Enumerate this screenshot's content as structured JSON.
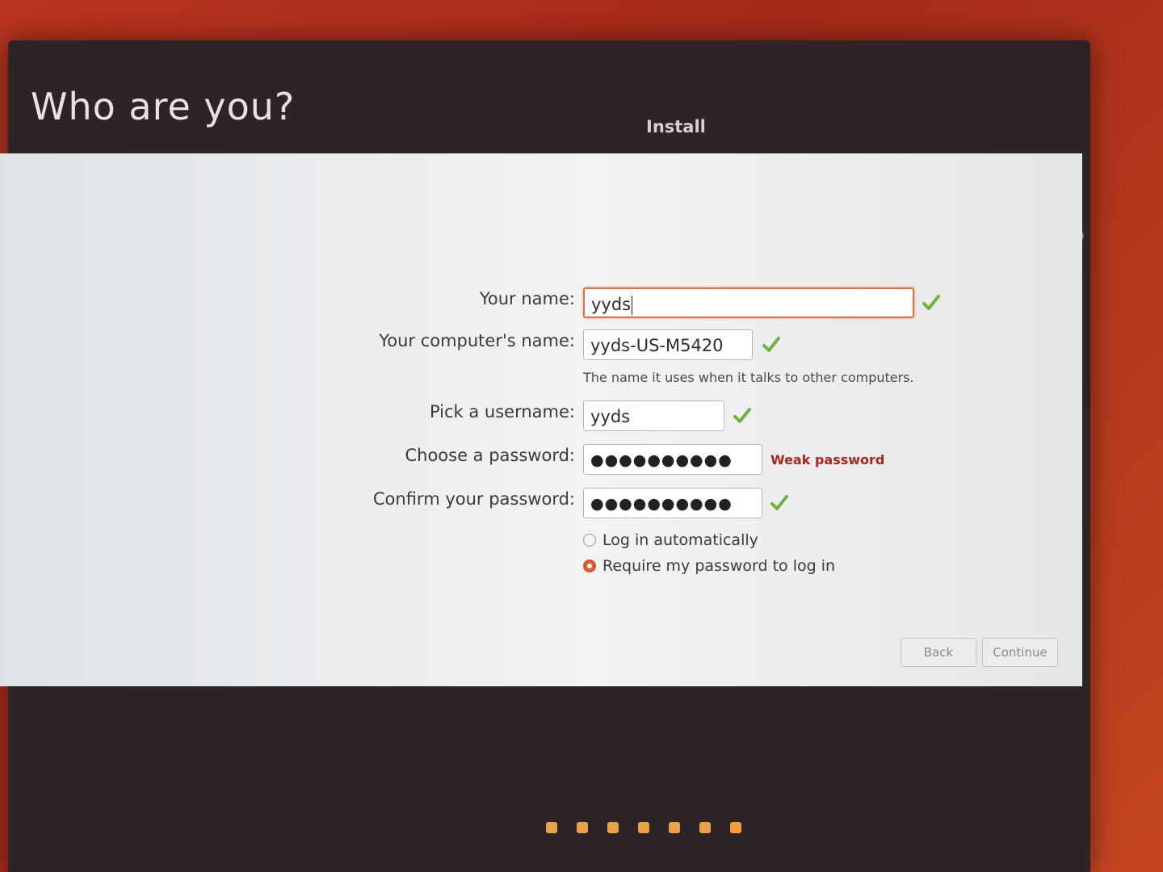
{
  "window": {
    "heading": "Who are you?",
    "title": "Install"
  },
  "form": {
    "name": {
      "label": "Your name:",
      "value": "yyds"
    },
    "computer_name": {
      "label": "Your computer's name:",
      "value": "yyds-US-M5420",
      "hint": "The name it uses when it talks to other computers."
    },
    "username": {
      "label": "Pick a username:",
      "value": "yyds"
    },
    "password": {
      "label": "Choose a password:",
      "value": "●●●●●●●●●●",
      "strength": "Weak password"
    },
    "confirm_password": {
      "label": "Confirm your password:",
      "value": "●●●●●●●●●●"
    },
    "login_options": [
      {
        "label": "Log in automatically",
        "checked": false
      },
      {
        "label": "Require my password to log in",
        "checked": true
      }
    ]
  },
  "buttons": {
    "back": "Back",
    "continue": "Continue"
  },
  "progress": {
    "total_steps": 7
  },
  "colors": {
    "accent": "#e05b2f",
    "check": "#6fb33a",
    "weak": "#a8281c",
    "window_dark": "#2c2426"
  }
}
